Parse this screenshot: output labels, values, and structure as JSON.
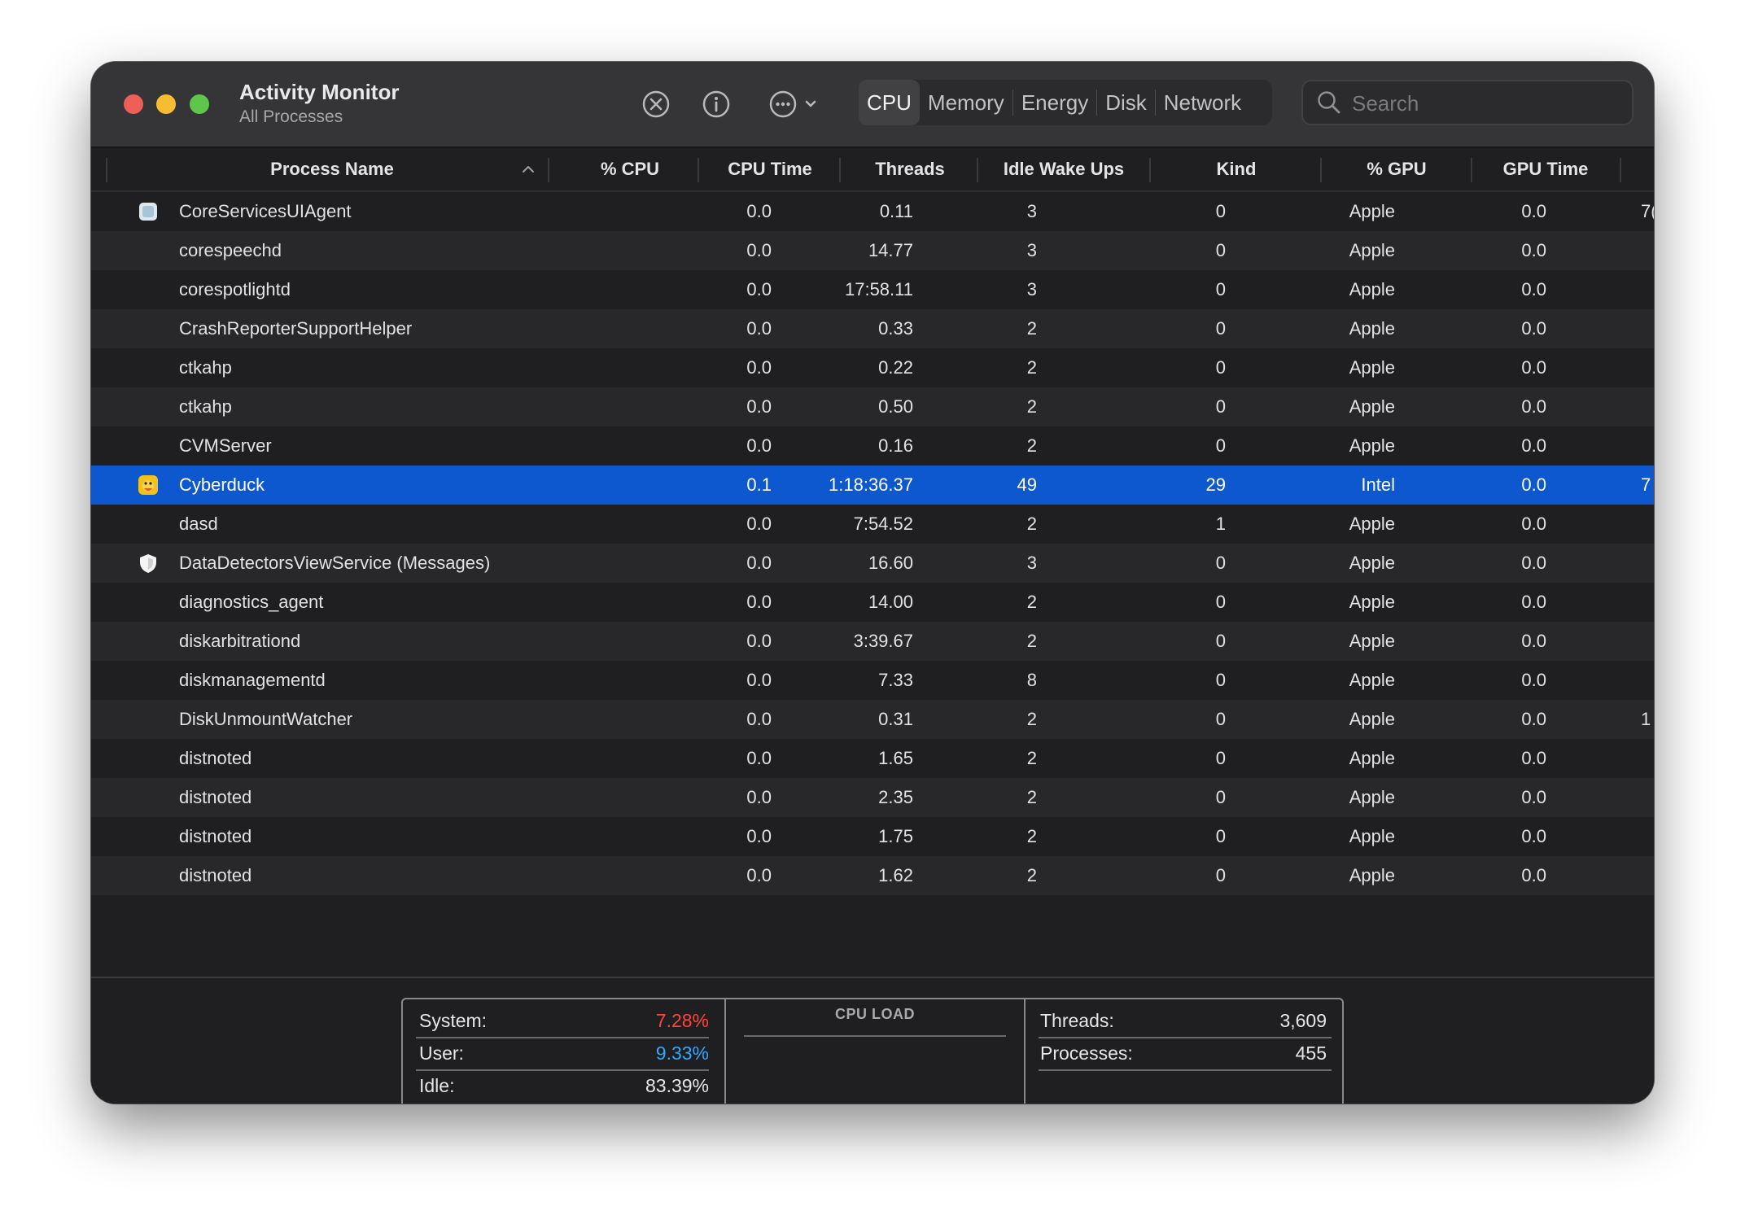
{
  "window": {
    "title": "Activity Monitor",
    "subtitle": "All Processes"
  },
  "toolbar": {
    "stop_icon": "stop-process-icon",
    "info_icon": "info-icon",
    "more_icon": "more-options-icon",
    "tabs": [
      {
        "label": "CPU",
        "active": true
      },
      {
        "label": "Memory",
        "active": false
      },
      {
        "label": "Energy",
        "active": false
      },
      {
        "label": "Disk",
        "active": false
      },
      {
        "label": "Network",
        "active": false
      }
    ],
    "search_placeholder": "Search",
    "search_value": ""
  },
  "table": {
    "columns": [
      "Process Name",
      "% CPU",
      "CPU Time",
      "Threads",
      "Idle Wake Ups",
      "Kind",
      "% GPU",
      "GPU Time"
    ],
    "sort_column": "Process Name",
    "sort_direction": "ascending",
    "rows": [
      {
        "name": "CoreServicesUIAgent",
        "cpu": "0.0",
        "cpu_time": "0.11",
        "threads": "3",
        "idle_wake_ups": "0",
        "kind": "Apple",
        "gpu": "0.0",
        "gpu_time": "0.00",
        "extra": "7(",
        "icon": "core-services-icon"
      },
      {
        "name": "corespeechd",
        "cpu": "0.0",
        "cpu_time": "14.77",
        "threads": "3",
        "idle_wake_ups": "0",
        "kind": "Apple",
        "gpu": "0.0",
        "gpu_time": "0.00",
        "extra": "",
        "icon": ""
      },
      {
        "name": "corespotlightd",
        "cpu": "0.0",
        "cpu_time": "17:58.11",
        "threads": "3",
        "idle_wake_ups": "0",
        "kind": "Apple",
        "gpu": "0.0",
        "gpu_time": "0.00",
        "extra": "",
        "icon": ""
      },
      {
        "name": "CrashReporterSupportHelper",
        "cpu": "0.0",
        "cpu_time": "0.33",
        "threads": "2",
        "idle_wake_ups": "0",
        "kind": "Apple",
        "gpu": "0.0",
        "gpu_time": "0.00",
        "extra": "",
        "icon": ""
      },
      {
        "name": "ctkahp",
        "cpu": "0.0",
        "cpu_time": "0.22",
        "threads": "2",
        "idle_wake_ups": "0",
        "kind": "Apple",
        "gpu": "0.0",
        "gpu_time": "0.00",
        "extra": "",
        "icon": ""
      },
      {
        "name": "ctkahp",
        "cpu": "0.0",
        "cpu_time": "0.50",
        "threads": "2",
        "idle_wake_ups": "0",
        "kind": "Apple",
        "gpu": "0.0",
        "gpu_time": "0.00",
        "extra": "",
        "icon": ""
      },
      {
        "name": "CVMServer",
        "cpu": "0.0",
        "cpu_time": "0.16",
        "threads": "2",
        "idle_wake_ups": "0",
        "kind": "Apple",
        "gpu": "0.0",
        "gpu_time": "0.00",
        "extra": "",
        "icon": ""
      },
      {
        "name": "Cyberduck",
        "cpu": "0.1",
        "cpu_time": "1:18:36.37",
        "threads": "49",
        "idle_wake_ups": "29",
        "kind": "Intel",
        "gpu": "0.0",
        "gpu_time": "0.01",
        "extra": "7",
        "icon": "cyberduck-app-icon",
        "selected": true
      },
      {
        "name": "dasd",
        "cpu": "0.0",
        "cpu_time": "7:54.52",
        "threads": "2",
        "idle_wake_ups": "1",
        "kind": "Apple",
        "gpu": "0.0",
        "gpu_time": "0.00",
        "extra": "",
        "icon": ""
      },
      {
        "name": "DataDetectorsViewService (Messages)",
        "cpu": "0.0",
        "cpu_time": "16.60",
        "threads": "3",
        "idle_wake_ups": "0",
        "kind": "Apple",
        "gpu": "0.0",
        "gpu_time": "0.00",
        "extra": "",
        "icon": "shield-icon"
      },
      {
        "name": "diagnostics_agent",
        "cpu": "0.0",
        "cpu_time": "14.00",
        "threads": "2",
        "idle_wake_ups": "0",
        "kind": "Apple",
        "gpu": "0.0",
        "gpu_time": "0.00",
        "extra": "",
        "icon": ""
      },
      {
        "name": "diskarbitrationd",
        "cpu": "0.0",
        "cpu_time": "3:39.67",
        "threads": "2",
        "idle_wake_ups": "0",
        "kind": "Apple",
        "gpu": "0.0",
        "gpu_time": "0.00",
        "extra": "",
        "icon": ""
      },
      {
        "name": "diskmanagementd",
        "cpu": "0.0",
        "cpu_time": "7.33",
        "threads": "8",
        "idle_wake_ups": "0",
        "kind": "Apple",
        "gpu": "0.0",
        "gpu_time": "0.00",
        "extra": "",
        "icon": ""
      },
      {
        "name": "DiskUnmountWatcher",
        "cpu": "0.0",
        "cpu_time": "0.31",
        "threads": "2",
        "idle_wake_ups": "0",
        "kind": "Apple",
        "gpu": "0.0",
        "gpu_time": "0.00",
        "extra": "1",
        "icon": ""
      },
      {
        "name": "distnoted",
        "cpu": "0.0",
        "cpu_time": "1.65",
        "threads": "2",
        "idle_wake_ups": "0",
        "kind": "Apple",
        "gpu": "0.0",
        "gpu_time": "0.00",
        "extra": "",
        "icon": ""
      },
      {
        "name": "distnoted",
        "cpu": "0.0",
        "cpu_time": "2.35",
        "threads": "2",
        "idle_wake_ups": "0",
        "kind": "Apple",
        "gpu": "0.0",
        "gpu_time": "0.00",
        "extra": "",
        "icon": ""
      },
      {
        "name": "distnoted",
        "cpu": "0.0",
        "cpu_time": "1.75",
        "threads": "2",
        "idle_wake_ups": "0",
        "kind": "Apple",
        "gpu": "0.0",
        "gpu_time": "0.00",
        "extra": "",
        "icon": ""
      },
      {
        "name": "distnoted",
        "cpu": "0.0",
        "cpu_time": "1.62",
        "threads": "2",
        "idle_wake_ups": "0",
        "kind": "Apple",
        "gpu": "0.0",
        "gpu_time": "0.00",
        "extra": "",
        "icon": ""
      }
    ]
  },
  "summary": {
    "system_label": "System:",
    "system_value": "7.28%",
    "user_label": "User:",
    "user_value": "9.33%",
    "idle_label": "Idle:",
    "idle_value": "83.39%",
    "cpu_load_title": "CPU LOAD",
    "threads_label": "Threads:",
    "threads_value": "3,609",
    "processes_label": "Processes:",
    "processes_value": "455"
  },
  "colors": {
    "system": "#ff453a",
    "user": "#30a8ff",
    "selection": "#0d58cf"
  }
}
